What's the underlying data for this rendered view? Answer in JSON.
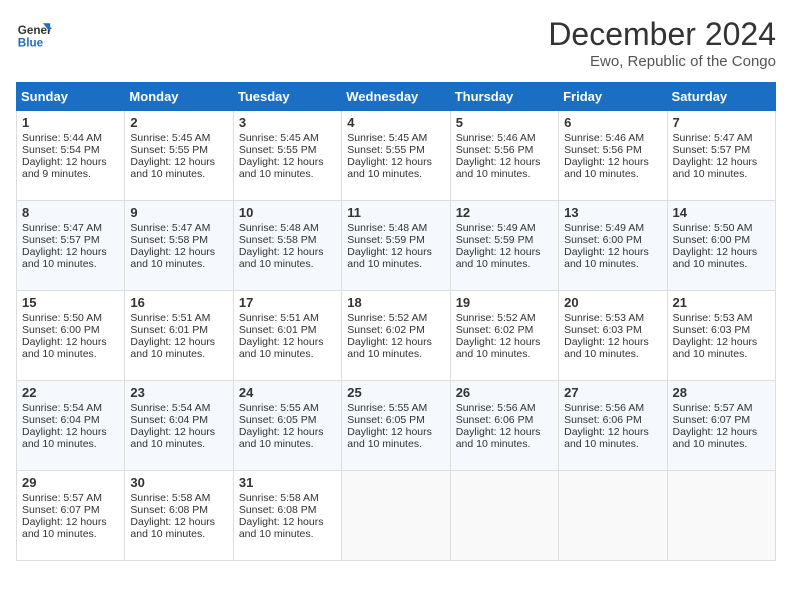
{
  "header": {
    "logo_general": "General",
    "logo_blue": "Blue",
    "month": "December 2024",
    "location": "Ewo, Republic of the Congo"
  },
  "days_of_week": [
    "Sunday",
    "Monday",
    "Tuesday",
    "Wednesday",
    "Thursday",
    "Friday",
    "Saturday"
  ],
  "weeks": [
    [
      {
        "day": 1,
        "rise": "5:44 AM",
        "set": "5:54 PM",
        "daylight": "12 hours and 9 minutes."
      },
      {
        "day": 2,
        "rise": "5:45 AM",
        "set": "5:55 PM",
        "daylight": "12 hours and 10 minutes."
      },
      {
        "day": 3,
        "rise": "5:45 AM",
        "set": "5:55 PM",
        "daylight": "12 hours and 10 minutes."
      },
      {
        "day": 4,
        "rise": "5:45 AM",
        "set": "5:55 PM",
        "daylight": "12 hours and 10 minutes."
      },
      {
        "day": 5,
        "rise": "5:46 AM",
        "set": "5:56 PM",
        "daylight": "12 hours and 10 minutes."
      },
      {
        "day": 6,
        "rise": "5:46 AM",
        "set": "5:56 PM",
        "daylight": "12 hours and 10 minutes."
      },
      {
        "day": 7,
        "rise": "5:47 AM",
        "set": "5:57 PM",
        "daylight": "12 hours and 10 minutes."
      }
    ],
    [
      {
        "day": 8,
        "rise": "5:47 AM",
        "set": "5:57 PM",
        "daylight": "12 hours and 10 minutes."
      },
      {
        "day": 9,
        "rise": "5:47 AM",
        "set": "5:58 PM",
        "daylight": "12 hours and 10 minutes."
      },
      {
        "day": 10,
        "rise": "5:48 AM",
        "set": "5:58 PM",
        "daylight": "12 hours and 10 minutes."
      },
      {
        "day": 11,
        "rise": "5:48 AM",
        "set": "5:59 PM",
        "daylight": "12 hours and 10 minutes."
      },
      {
        "day": 12,
        "rise": "5:49 AM",
        "set": "5:59 PM",
        "daylight": "12 hours and 10 minutes."
      },
      {
        "day": 13,
        "rise": "5:49 AM",
        "set": "6:00 PM",
        "daylight": "12 hours and 10 minutes."
      },
      {
        "day": 14,
        "rise": "5:50 AM",
        "set": "6:00 PM",
        "daylight": "12 hours and 10 minutes."
      }
    ],
    [
      {
        "day": 15,
        "rise": "5:50 AM",
        "set": "6:00 PM",
        "daylight": "12 hours and 10 minutes."
      },
      {
        "day": 16,
        "rise": "5:51 AM",
        "set": "6:01 PM",
        "daylight": "12 hours and 10 minutes."
      },
      {
        "day": 17,
        "rise": "5:51 AM",
        "set": "6:01 PM",
        "daylight": "12 hours and 10 minutes."
      },
      {
        "day": 18,
        "rise": "5:52 AM",
        "set": "6:02 PM",
        "daylight": "12 hours and 10 minutes."
      },
      {
        "day": 19,
        "rise": "5:52 AM",
        "set": "6:02 PM",
        "daylight": "12 hours and 10 minutes."
      },
      {
        "day": 20,
        "rise": "5:53 AM",
        "set": "6:03 PM",
        "daylight": "12 hours and 10 minutes."
      },
      {
        "day": 21,
        "rise": "5:53 AM",
        "set": "6:03 PM",
        "daylight": "12 hours and 10 minutes."
      }
    ],
    [
      {
        "day": 22,
        "rise": "5:54 AM",
        "set": "6:04 PM",
        "daylight": "12 hours and 10 minutes."
      },
      {
        "day": 23,
        "rise": "5:54 AM",
        "set": "6:04 PM",
        "daylight": "12 hours and 10 minutes."
      },
      {
        "day": 24,
        "rise": "5:55 AM",
        "set": "6:05 PM",
        "daylight": "12 hours and 10 minutes."
      },
      {
        "day": 25,
        "rise": "5:55 AM",
        "set": "6:05 PM",
        "daylight": "12 hours and 10 minutes."
      },
      {
        "day": 26,
        "rise": "5:56 AM",
        "set": "6:06 PM",
        "daylight": "12 hours and 10 minutes."
      },
      {
        "day": 27,
        "rise": "5:56 AM",
        "set": "6:06 PM",
        "daylight": "12 hours and 10 minutes."
      },
      {
        "day": 28,
        "rise": "5:57 AM",
        "set": "6:07 PM",
        "daylight": "12 hours and 10 minutes."
      }
    ],
    [
      {
        "day": 29,
        "rise": "5:57 AM",
        "set": "6:07 PM",
        "daylight": "12 hours and 10 minutes."
      },
      {
        "day": 30,
        "rise": "5:58 AM",
        "set": "6:08 PM",
        "daylight": "12 hours and 10 minutes."
      },
      {
        "day": 31,
        "rise": "5:58 AM",
        "set": "6:08 PM",
        "daylight": "12 hours and 10 minutes."
      },
      null,
      null,
      null,
      null
    ]
  ]
}
